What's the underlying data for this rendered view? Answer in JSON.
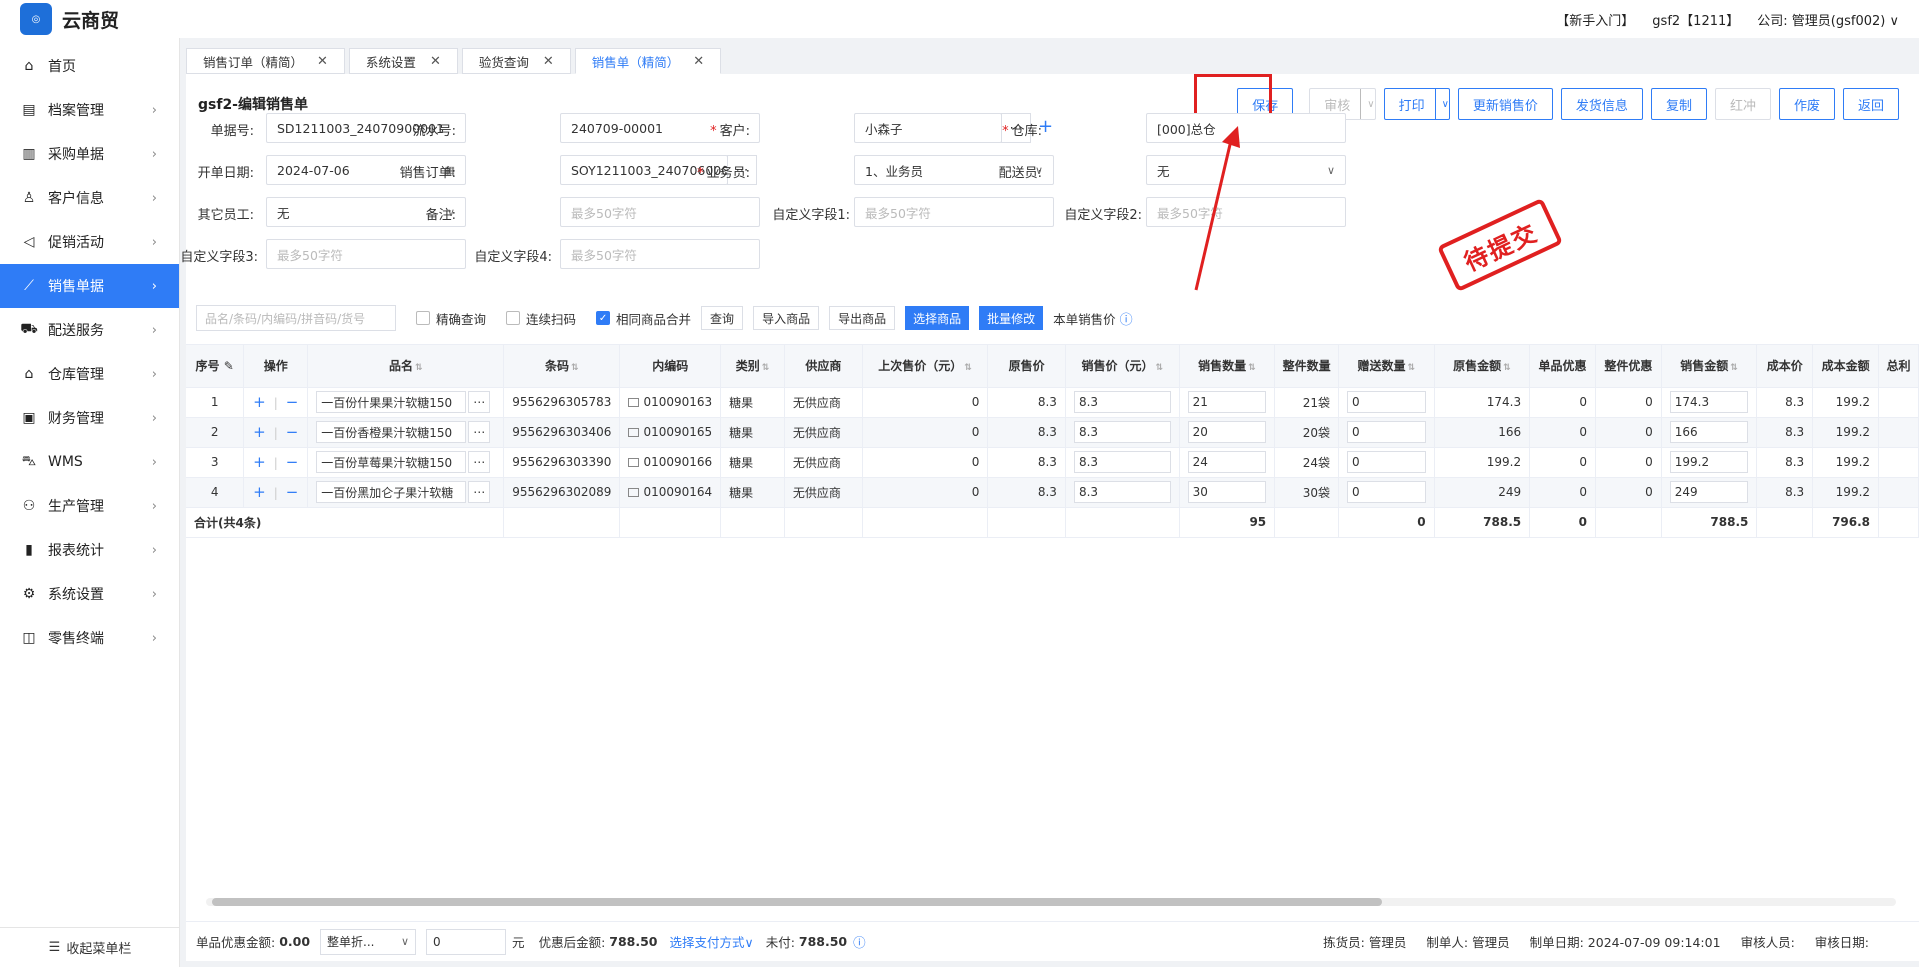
{
  "app": {
    "title": "云商贸",
    "logo_text": "云商贸"
  },
  "topbar": {
    "guide": "【新手入门】",
    "user": "gsf2【1211】",
    "company": "公司: 管理员(gsf002)",
    "chevron": "∨"
  },
  "sidebar": {
    "items": [
      {
        "label": "首页",
        "icon": "home-icon"
      },
      {
        "label": "档案管理",
        "icon": "archive-icon"
      },
      {
        "label": "采购单据",
        "icon": "purchase-icon"
      },
      {
        "label": "客户信息",
        "icon": "user-icon"
      },
      {
        "label": "促销活动",
        "icon": "megaphone-icon"
      },
      {
        "label": "销售单据",
        "icon": "chart-icon",
        "active": true
      },
      {
        "label": "配送服务",
        "icon": "cart-icon"
      },
      {
        "label": "仓库管理",
        "icon": "warehouse-icon"
      },
      {
        "label": "财务管理",
        "icon": "finance-icon"
      },
      {
        "label": "WMS",
        "icon": "truck-icon"
      },
      {
        "label": "生产管理",
        "icon": "production-icon"
      },
      {
        "label": "报表统计",
        "icon": "report-icon"
      },
      {
        "label": "系统设置",
        "icon": "gear-icon"
      },
      {
        "label": "零售终端",
        "icon": "bag-icon"
      }
    ],
    "collapse_label": "收起菜单栏"
  },
  "tabs": [
    {
      "label": "销售订单（精简）"
    },
    {
      "label": "系统设置"
    },
    {
      "label": "验货查询"
    },
    {
      "label": "销售单（精简）",
      "active": true
    }
  ],
  "page": {
    "title": "gsf2-编辑销售单",
    "stamp": "待提交"
  },
  "toolbar": {
    "save": "保存",
    "audit": "审核",
    "print": "打印",
    "update_price": "更新销售价",
    "ship_info": "发货信息",
    "copy": "复制",
    "red": "红冲",
    "void": "作废",
    "back": "返回"
  },
  "form": {
    "doc_no_label": "单据号:",
    "doc_no": "SD1211003_24070900001",
    "serial_label": "流水号:",
    "serial": "240709-00001",
    "customer_label": "客户:",
    "customer": "小森子",
    "warehouse_label": "仓库:",
    "warehouse": "[000]总仓",
    "date_label": "开单日期:",
    "date": "2024-07-06",
    "sales_order_label": "销售订单:",
    "sales_order": "SOY1211003_2407060000",
    "salesman_label": "业务员:",
    "salesman": "1、业务员",
    "delivery_label": "配送员:",
    "delivery": "无",
    "other_staff_label": "其它员工:",
    "other_staff": "无",
    "remark_label": "备注:",
    "remark_ph": "最多50字符",
    "custom1_label": "自定义字段1:",
    "custom1_ph": "最多50字符",
    "custom2_label": "自定义字段2:",
    "custom2_ph": "最多50字符",
    "custom3_label": "自定义字段3:",
    "custom3_ph": "最多50字符",
    "custom4_label": "自定义字段4:",
    "custom4_ph": "最多50字符"
  },
  "filter": {
    "search_ph": "品名/条码/内编码/拼音码/货号",
    "exact": "精确查询",
    "continuous": "连续扫码",
    "merge": "相同商品合并",
    "query": "查询",
    "import": "导入商品",
    "export": "导出商品",
    "select": "选择商品",
    "batch": "批量修改",
    "price_label": "本单销售价"
  },
  "table": {
    "headers": [
      "序号",
      "操作",
      "品名",
      "条码",
      "内编码",
      "类别",
      "供应商",
      "上次售价（元）",
      "原售价",
      "销售价（元）",
      "销售数量",
      "整件数量",
      "赠送数量",
      "原售金额",
      "单品优惠",
      "整件优惠",
      "销售金额",
      "成本价",
      "成本金额",
      "总利"
    ],
    "rows": [
      {
        "no": "1",
        "name": "一百份什果果汁软糖150",
        "barcode": "9556296305783",
        "code": "010090163",
        "cat": "糖果",
        "supplier": "无供应商",
        "last_price": "0",
        "orig_price": "8.3",
        "price": "8.3",
        "qty": "21",
        "pack": "21袋",
        "gift": "0",
        "orig_amt": "174.3",
        "item_disc": "0",
        "pack_disc": "0",
        "amount": "174.3",
        "cost": "8.3",
        "cost_amt": "199.2"
      },
      {
        "no": "2",
        "name": "一百份香橙果汁软糖150",
        "barcode": "9556296303406",
        "code": "010090165",
        "cat": "糖果",
        "supplier": "无供应商",
        "last_price": "0",
        "orig_price": "8.3",
        "price": "8.3",
        "qty": "20",
        "pack": "20袋",
        "gift": "0",
        "orig_amt": "166",
        "item_disc": "0",
        "pack_disc": "0",
        "amount": "166",
        "cost": "8.3",
        "cost_amt": "199.2"
      },
      {
        "no": "3",
        "name": "一百份草莓果汁软糖150",
        "barcode": "9556296303390",
        "code": "010090166",
        "cat": "糖果",
        "supplier": "无供应商",
        "last_price": "0",
        "orig_price": "8.3",
        "price": "8.3",
        "qty": "24",
        "pack": "24袋",
        "gift": "0",
        "orig_amt": "199.2",
        "item_disc": "0",
        "pack_disc": "0",
        "amount": "199.2",
        "cost": "8.3",
        "cost_amt": "199.2"
      },
      {
        "no": "4",
        "name": "一百份黑加仑子果汁软糖",
        "barcode": "9556296302089",
        "code": "010090164",
        "cat": "糖果",
        "supplier": "无供应商",
        "last_price": "0",
        "orig_price": "8.3",
        "price": "8.3",
        "qty": "30",
        "pack": "30袋",
        "gift": "0",
        "orig_amt": "249",
        "item_disc": "0",
        "pack_disc": "0",
        "amount": "249",
        "cost": "8.3",
        "cost_amt": "199.2"
      }
    ],
    "total": {
      "label": "合计(共4条)",
      "qty": "95",
      "gift": "0",
      "orig_amt": "788.5",
      "item_disc": "0",
      "amount": "788.5",
      "cost_amt": "796.8"
    }
  },
  "footer": {
    "item_disc_label": "单品优惠金额:",
    "item_disc": "0.00",
    "whole_disc": "整单折...",
    "disc_value": "0",
    "unit": "元",
    "after_label": "优惠后金额:",
    "after": "788.50",
    "pay_method": "选择支付方式",
    "unpaid_label": "未付:",
    "unpaid": "788.50",
    "picker_label": "拣货员:",
    "picker": "管理员",
    "maker_label": "制单人:",
    "maker": "管理员",
    "date_label": "制单日期:",
    "date": "2024-07-09 09:14:01",
    "auditor_label": "审核人员:",
    "audit_date_label": "审核日期:"
  }
}
